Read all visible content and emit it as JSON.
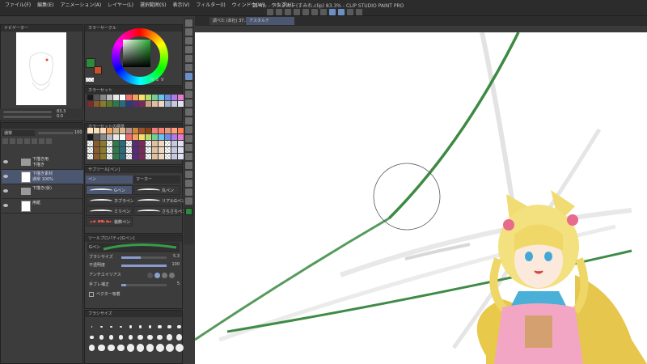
{
  "menu": {
    "items": [
      "ファイル(F)",
      "編集(E)",
      "アニメーション(A)",
      "レイヤー(L)",
      "選択範囲(S)",
      "表示(V)",
      "フィルター(I)",
      "ウィンドウ(W)",
      "ヘルプ(H)"
    ]
  },
  "window": {
    "title": "調べた - アスタルテ(すみれ.clip) 83.3% - CLIP STUDIO PAINT PRO"
  },
  "navigator": {
    "title": "ナビゲーター",
    "zoom": "83.3",
    "rotate": "0.0"
  },
  "layers": {
    "blend_mode": "通常",
    "opacity": "100",
    "rows": [
      {
        "name": "下描き用",
        "sub": "下描き",
        "type": "folder"
      },
      {
        "name": "下描き素材",
        "sub": "通常 100%",
        "type": "layer",
        "selected": true
      },
      {
        "name": "下描き(仮)",
        "sub": "",
        "type": "folder"
      },
      {
        "name": "用紙",
        "sub": "",
        "type": "paper"
      }
    ]
  },
  "color": {
    "panel_title": "カラーサークル",
    "main_color": "#2c8a3a",
    "sub_color": "#c8512e",
    "hsv": [
      "H",
      "S",
      "V"
    ]
  },
  "palette": {
    "title": "カラーセット",
    "set2_title": "カラーセットの標準",
    "row1": [
      "#1a1a1a",
      "#555555",
      "#888888",
      "#bbbbbb",
      "#e8e8e8",
      "#ffffff",
      "#f26b6b",
      "#f6a35a",
      "#f7e06a",
      "#b3dc6a",
      "#6fcf97",
      "#6ac3e8",
      "#6b8de8",
      "#b07ae8",
      "#e87ad0"
    ],
    "row2": [
      "#7a2b2b",
      "#8a5a2a",
      "#8a7a2a",
      "#5a7a2a",
      "#2a7a4a",
      "#2a6a7a",
      "#2a3a7a",
      "#5a2a7a",
      "#7a2a5a",
      "#c8a080",
      "#e0c0a0",
      "#f0d8c0",
      "#a0b0c8",
      "#c8c8e0",
      "#e0e0f0"
    ],
    "row3": [
      "#ffe4c4",
      "#f5deb3",
      "#ffdab9",
      "#f4a460",
      "#d2b48c",
      "#deb887",
      "#bc8f8f",
      "#cd853f",
      "#a0522d",
      "#8b4513",
      "#f08080",
      "#fa8072",
      "#e9967a",
      "#ffa07a",
      "#ff7f50"
    ]
  },
  "sub_tool": {
    "title": "サブツール[ペン]",
    "tabs": [
      "ペン",
      "マーカー"
    ],
    "brushes": [
      {
        "name": "Gペン",
        "selected": true
      },
      {
        "name": "丸ペン"
      },
      {
        "name": "カブラペン"
      },
      {
        "name": "リアルGペン"
      },
      {
        "name": "ミリペン"
      },
      {
        "name": "さらさらペン"
      },
      {
        "name": "装飾ペン"
      }
    ]
  },
  "tool_property": {
    "title": "ツールプロパティ[Gペン]",
    "preview_label": "Gペン",
    "brush_size_label": "ブラシサイズ",
    "brush_size": "5.3",
    "brush_size_fraction": 0.42,
    "opacity_label": "不透明度",
    "opacity": "100",
    "opacity_fraction": 1.0,
    "antialias_label": "アンチエイリアス",
    "stabilize_label": "手ブレ補正",
    "stabilize": "5",
    "stabilize_fraction": 0.1,
    "vector_snap_label": "ベクター吸着"
  },
  "brush_size_panel": {
    "title": "ブラシサイズ",
    "sizes": [
      "0.7",
      "1",
      "1.5",
      "2",
      "2.5",
      "3",
      "4",
      "5",
      "6",
      "7",
      "8",
      "10",
      "12",
      "15",
      "17",
      "20",
      "25",
      "30",
      "40",
      "50",
      "60",
      "70",
      "80",
      "100",
      "120",
      "150",
      "170",
      "200",
      "250",
      "300"
    ]
  },
  "canvas": {
    "tabs": [
      "調べた (本社) 37.3%",
      "アスタルテ"
    ]
  }
}
